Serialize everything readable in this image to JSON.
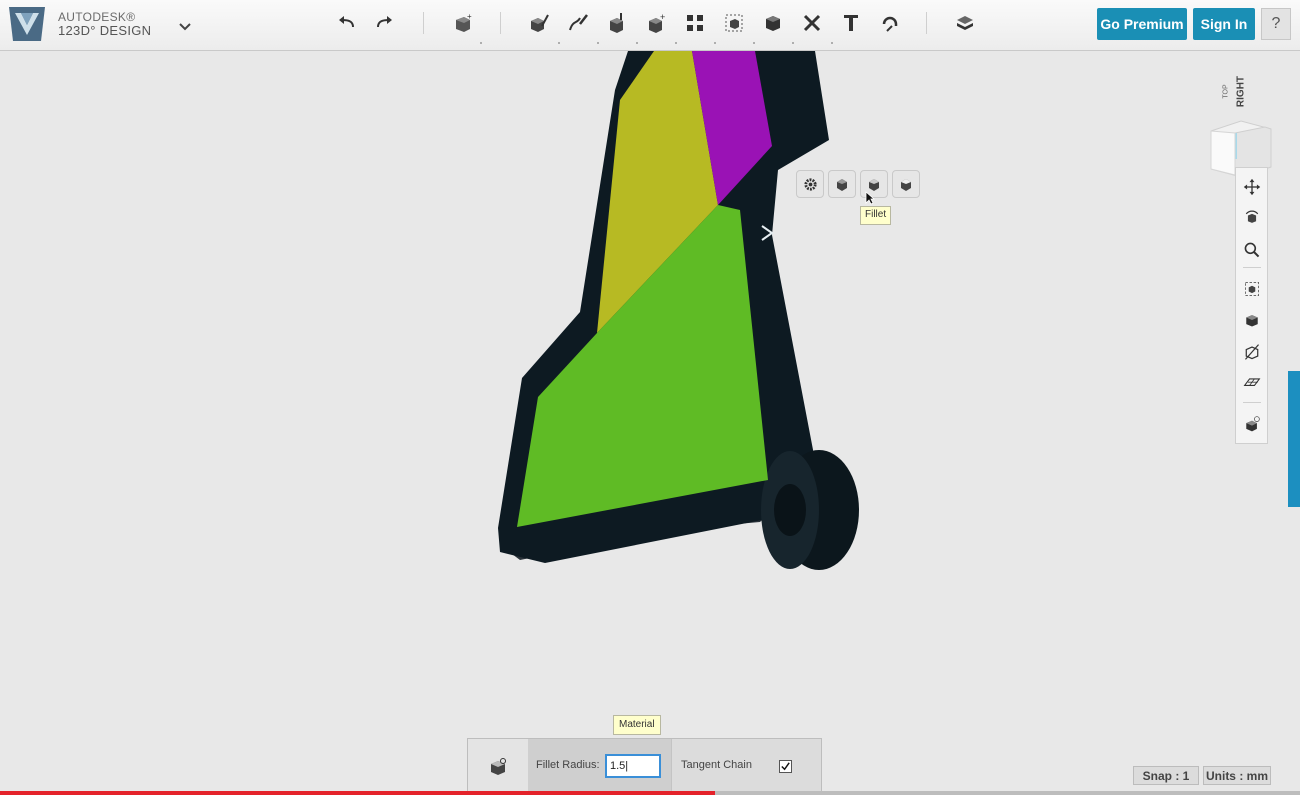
{
  "brand": {
    "company": "AUTODESK®",
    "product": "123D° DESIGN"
  },
  "toolbar": {
    "tools": [
      "undo-icon",
      "redo-icon",
      "primitives-icon",
      "sketch-icon",
      "construct-icon",
      "modify-icon",
      "pattern-icon",
      "grouping-icon",
      "combine-icon",
      "measure-icon",
      "text-icon",
      "snap-icon",
      "material-icon"
    ]
  },
  "account": {
    "premium_label": "Go Premium",
    "signin_label": "Sign In",
    "help_label": "?"
  },
  "viewcube": {
    "face_right": "RIGHT",
    "face_top": "TOP"
  },
  "mini_toolbar": {
    "items": [
      "gear-icon",
      "chamfer-icon",
      "fillet-icon",
      "shell-icon"
    ],
    "tooltip": "Fillet"
  },
  "command": {
    "tooltip": "Material",
    "radius_label": "Fillet Radius:",
    "radius_value": "1.5|",
    "tangent_label": "Tangent Chain",
    "tangent_checked": true
  },
  "status": {
    "snap": "Snap : 1",
    "units": "Units : mm"
  },
  "colors": {
    "accent": "#1a8fb5",
    "part_body": "#0d1a22",
    "face_yellow": "#b7ba23",
    "face_purple": "#9a12b5",
    "face_green": "#5fbb25"
  },
  "video_progress": 0.55
}
